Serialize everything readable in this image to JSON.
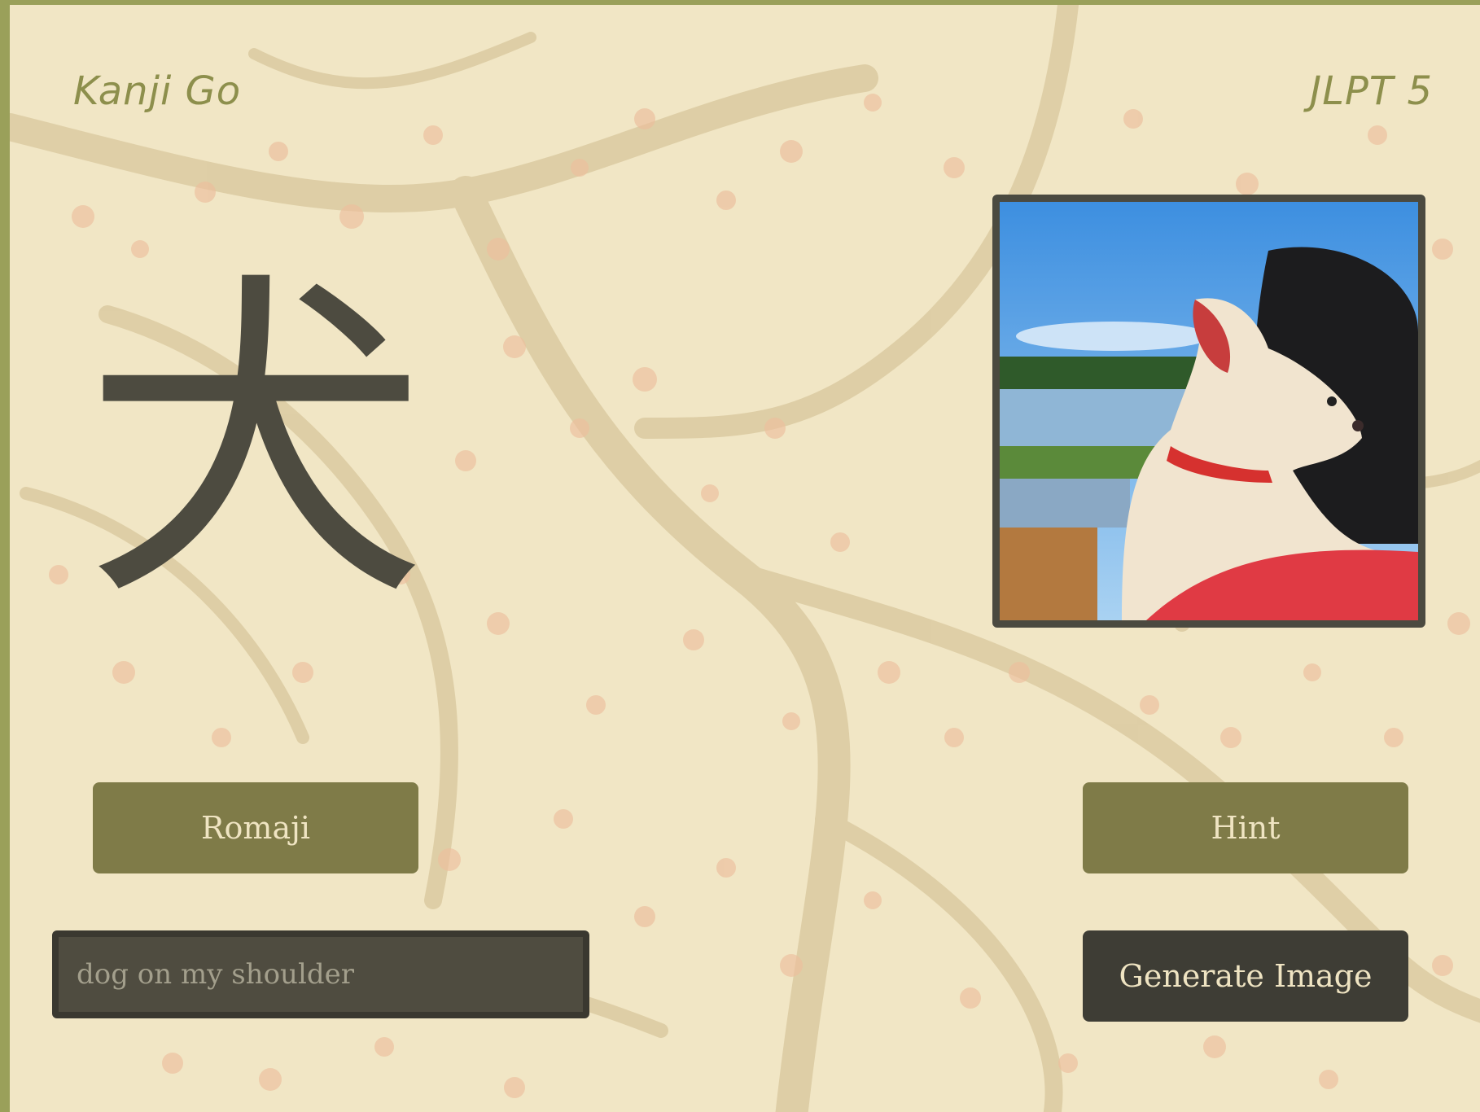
{
  "app": {
    "title": "Kanji Go",
    "level": "JLPT 5"
  },
  "card": {
    "kanji": "犬",
    "image_alt": "dog-on-shoulder-photo"
  },
  "buttons": {
    "romaji": "Romaji",
    "hint": "Hint",
    "generate": "Generate Image"
  },
  "prompt_input": {
    "value": "",
    "placeholder": "dog on my shoulder"
  },
  "colors": {
    "background": "#f1e6c5",
    "accent_olive": "#7f7b48",
    "dark": "#3e3d35",
    "kanji": "#4d4b40",
    "border": "#9aa05a"
  },
  "icons": {
    "background": "cherry-blossom-branches"
  }
}
